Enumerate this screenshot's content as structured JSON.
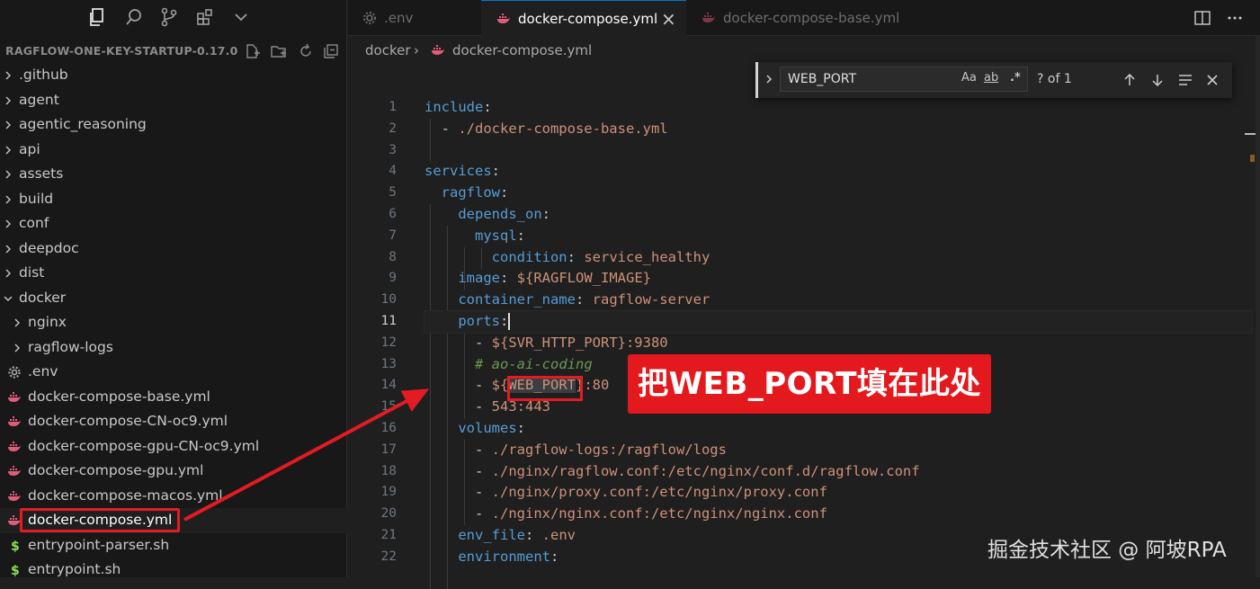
{
  "activity_bar": {
    "icons": [
      "explorer-icon",
      "search-icon",
      "source-control-icon",
      "extensions-icon",
      "chevron-down-icon"
    ]
  },
  "explorer": {
    "title": "RAGFLOW-ONE-KEY-STARTUP-0.17.0",
    "actions": [
      "new-file-icon",
      "new-folder-icon",
      "refresh-icon",
      "collapse-all-icon"
    ],
    "items": [
      {
        "label": ".github",
        "type": "folder",
        "expanded": false
      },
      {
        "label": "agent",
        "type": "folder",
        "expanded": false
      },
      {
        "label": "agentic_reasoning",
        "type": "folder",
        "expanded": false
      },
      {
        "label": "api",
        "type": "folder",
        "expanded": false
      },
      {
        "label": "assets",
        "type": "folder",
        "expanded": false
      },
      {
        "label": "build",
        "type": "folder",
        "expanded": false
      },
      {
        "label": "conf",
        "type": "folder",
        "expanded": false
      },
      {
        "label": "deepdoc",
        "type": "folder",
        "expanded": false
      },
      {
        "label": "dist",
        "type": "folder",
        "expanded": false
      },
      {
        "label": "docker",
        "type": "folder",
        "expanded": true
      },
      {
        "label": "nginx",
        "type": "folder",
        "expanded": false
      },
      {
        "label": "ragflow-logs",
        "type": "folder",
        "expanded": false
      },
      {
        "label": ".env",
        "type": "env"
      },
      {
        "label": "docker-compose-base.yml",
        "type": "docker"
      },
      {
        "label": "docker-compose-CN-oc9.yml",
        "type": "docker"
      },
      {
        "label": "docker-compose-gpu-CN-oc9.yml",
        "type": "docker"
      },
      {
        "label": "docker-compose-gpu.yml",
        "type": "docker"
      },
      {
        "label": "docker-compose-macos.yml",
        "type": "docker"
      },
      {
        "label": "docker-compose.yml",
        "type": "docker",
        "selected": true
      },
      {
        "label": "entrypoint-parser.sh",
        "type": "shell"
      },
      {
        "label": "entrypoint.sh",
        "type": "shell"
      }
    ]
  },
  "tabs": [
    {
      "label": ".env",
      "icon": "gear-icon",
      "active": false
    },
    {
      "label": "docker-compose.yml",
      "icon": "docker-icon",
      "active": true,
      "close": "×"
    },
    {
      "label": "docker-compose-base.yml",
      "icon": "docker-icon",
      "active": false
    }
  ],
  "breadcrumb": {
    "folder": "docker",
    "separator": "›",
    "file": "docker-compose.yml"
  },
  "find_widget": {
    "value": "WEB_PORT",
    "opt_case": "Aa",
    "opt_word": "ab",
    "opt_regex": ".*",
    "count": "? of 1"
  },
  "editor": {
    "current_line": 11,
    "lines": [
      {
        "n": "1",
        "segs": [
          {
            "t": "include",
            "c": "k"
          },
          {
            "t": ":",
            "c": "p"
          }
        ]
      },
      {
        "n": "2",
        "segs": [
          {
            "t": "  - ",
            "c": "p"
          },
          {
            "t": "./docker-compose-base.yml",
            "c": "s"
          }
        ]
      },
      {
        "n": "3",
        "segs": []
      },
      {
        "n": "4",
        "segs": [
          {
            "t": "services",
            "c": "k"
          },
          {
            "t": ":",
            "c": "p"
          }
        ]
      },
      {
        "n": "5",
        "segs": [
          {
            "t": "  ",
            "c": "p"
          },
          {
            "t": "ragflow",
            "c": "k"
          },
          {
            "t": ":",
            "c": "p"
          }
        ]
      },
      {
        "n": "6",
        "segs": [
          {
            "t": "    ",
            "c": "p"
          },
          {
            "t": "depends_on",
            "c": "k"
          },
          {
            "t": ":",
            "c": "p"
          }
        ]
      },
      {
        "n": "7",
        "segs": [
          {
            "t": "      ",
            "c": "p"
          },
          {
            "t": "mysql",
            "c": "k"
          },
          {
            "t": ":",
            "c": "p"
          }
        ]
      },
      {
        "n": "8",
        "segs": [
          {
            "t": "        ",
            "c": "p"
          },
          {
            "t": "condition",
            "c": "k"
          },
          {
            "t": ": ",
            "c": "p"
          },
          {
            "t": "service_healthy",
            "c": "s"
          }
        ]
      },
      {
        "n": "9",
        "segs": [
          {
            "t": "    ",
            "c": "p"
          },
          {
            "t": "image",
            "c": "k"
          },
          {
            "t": ": ",
            "c": "p"
          },
          {
            "t": "${RAGFLOW_IMAGE}",
            "c": "s"
          }
        ]
      },
      {
        "n": "10",
        "segs": [
          {
            "t": "    ",
            "c": "p"
          },
          {
            "t": "container_name",
            "c": "k"
          },
          {
            "t": ": ",
            "c": "p"
          },
          {
            "t": "ragflow-server",
            "c": "s"
          }
        ]
      },
      {
        "n": "11",
        "segs": [
          {
            "t": "    ",
            "c": "p"
          },
          {
            "t": "ports",
            "c": "k"
          },
          {
            "t": ":",
            "c": "p"
          }
        ]
      },
      {
        "n": "12",
        "segs": [
          {
            "t": "      - ",
            "c": "p"
          },
          {
            "t": "${SVR_HTTP_PORT}:9380",
            "c": "s"
          }
        ]
      },
      {
        "n": "13",
        "segs": [
          {
            "t": "      ",
            "c": "p"
          },
          {
            "t": "# ao-ai-coding",
            "c": "c"
          }
        ]
      },
      {
        "n": "14",
        "segs": [
          {
            "t": "      - ",
            "c": "p"
          },
          {
            "t": "${",
            "c": "s"
          },
          {
            "t": "WEB_PORT",
            "c": "s hl"
          },
          {
            "t": "}:80",
            "c": "s"
          }
        ]
      },
      {
        "n": "15",
        "segs": [
          {
            "t": "      - ",
            "c": "p"
          },
          {
            "t": "543:443",
            "c": "s"
          }
        ]
      },
      {
        "n": "16",
        "segs": [
          {
            "t": "    ",
            "c": "p"
          },
          {
            "t": "volumes",
            "c": "k"
          },
          {
            "t": ":",
            "c": "p"
          }
        ]
      },
      {
        "n": "17",
        "segs": [
          {
            "t": "      - ",
            "c": "p"
          },
          {
            "t": "./ragflow-logs:/ragflow/logs",
            "c": "s"
          }
        ]
      },
      {
        "n": "18",
        "segs": [
          {
            "t": "      - ",
            "c": "p"
          },
          {
            "t": "./nginx/ragflow.conf:/etc/nginx/conf.d/ragflow.conf",
            "c": "s"
          }
        ]
      },
      {
        "n": "19",
        "segs": [
          {
            "t": "      - ",
            "c": "p"
          },
          {
            "t": "./nginx/proxy.conf:/etc/nginx/proxy.conf",
            "c": "s"
          }
        ]
      },
      {
        "n": "20",
        "segs": [
          {
            "t": "      - ",
            "c": "p"
          },
          {
            "t": "./nginx/nginx.conf:/etc/nginx/nginx.conf",
            "c": "s"
          }
        ]
      },
      {
        "n": "21",
        "segs": [
          {
            "t": "    ",
            "c": "p"
          },
          {
            "t": "env_file",
            "c": "k"
          },
          {
            "t": ": ",
            "c": "p"
          },
          {
            "t": ".env",
            "c": "s"
          }
        ]
      },
      {
        "n": "22",
        "segs": [
          {
            "t": "    ",
            "c": "p"
          },
          {
            "t": "environment",
            "c": "k"
          },
          {
            "t": ":",
            "c": "p"
          }
        ]
      }
    ]
  },
  "annotation": {
    "text": "把WEB_PORT填在此处",
    "color": "#e3191d"
  },
  "watermark": "掘金技术社区 @ 阿坡RPA",
  "colors": {
    "accent": "#0078d4",
    "highlight_red": "#e31b23",
    "docker_icon": "#e05d7a"
  }
}
